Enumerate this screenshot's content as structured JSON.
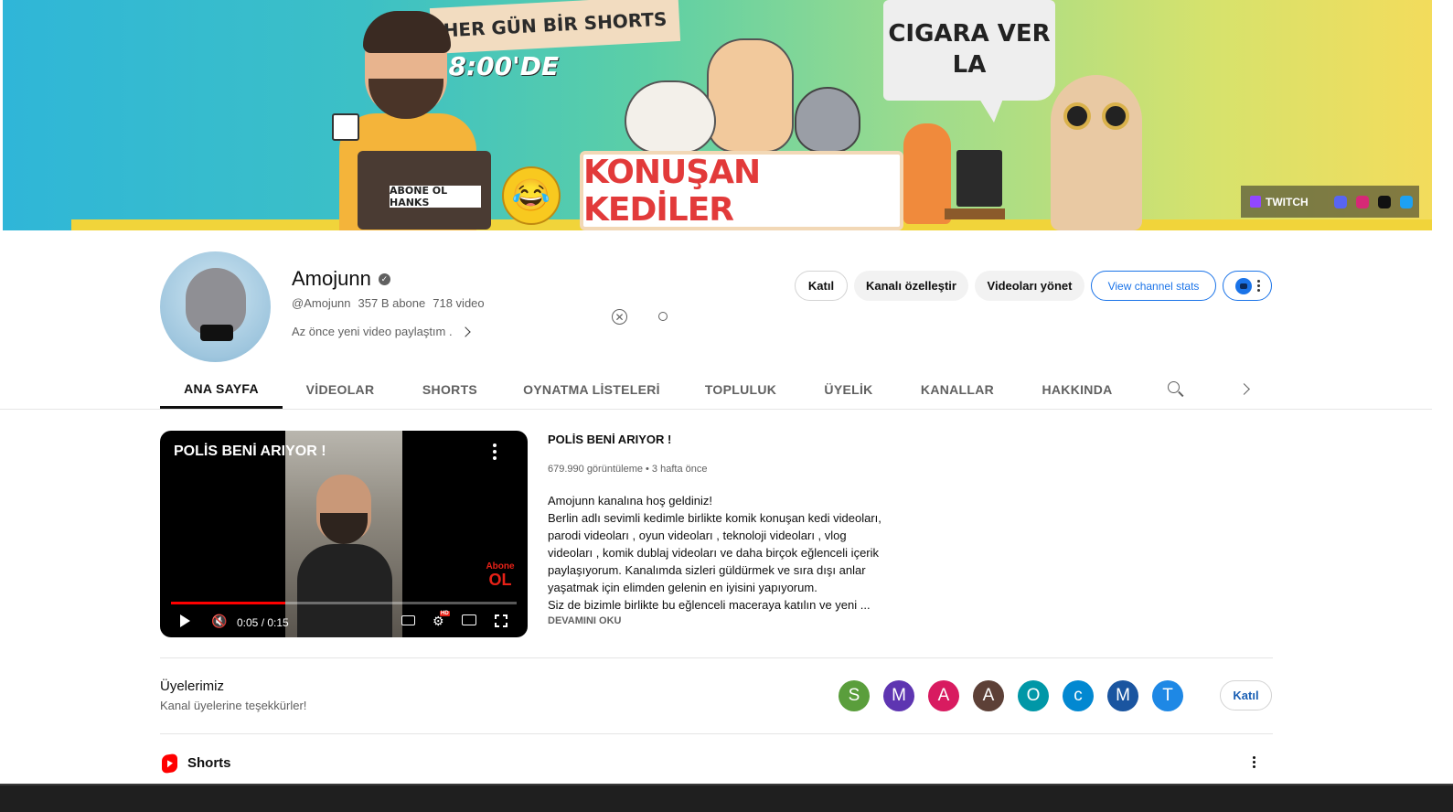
{
  "banner": {
    "shorts_sign": "HER GÜN BİR SHORTS",
    "time_text": "18:00'DE",
    "speech_line1": "CIGARA VER",
    "speech_line2": "LA",
    "laptop_label": "ABONE OL HANKS",
    "title_board": "KONUŞAN KEDİLER",
    "socials_label": "TWITCH",
    "social_colors": {
      "discord": "#5865f2",
      "instagram": "#d62976",
      "tiktok": "#111111",
      "twitter": "#1da1f2"
    }
  },
  "channel": {
    "name": "Amojunn",
    "verified_glyph": "✓",
    "handle": "@Amojunn",
    "subscribers": "357 B abone",
    "videos": "718 video",
    "description": "Az önce yeni video paylaştım .",
    "clear_glyph": "✕"
  },
  "actions": {
    "join": "Katıl",
    "customize": "Kanalı özelleştir",
    "manage_videos": "Videoları yönet",
    "stats": "View channel stats"
  },
  "tabs": [
    {
      "label": "ANA SAYFA",
      "active": true
    },
    {
      "label": "VİDEOLAR",
      "active": false
    },
    {
      "label": "SHORTS",
      "active": false
    },
    {
      "label": "OYNATMA LİSTELERİ",
      "active": false
    },
    {
      "label": "TOPLULUK",
      "active": false
    },
    {
      "label": "ÜYELİK",
      "active": false
    },
    {
      "label": "KANALLAR",
      "active": false
    },
    {
      "label": "HAKKINDA",
      "active": false
    }
  ],
  "featured_video": {
    "overlay_title": "POLİS BENİ ARIYOR !",
    "title": "POLİS BENİ ARIYOR !",
    "stats": "679.990 görüntüleme • 3 hafta önce",
    "time": "0:05 / 0:15",
    "progress": 0.33,
    "badge_top": "Abone",
    "badge_bottom": "OL",
    "hd": "HD",
    "mute_glyph": "🔇",
    "settings_glyph": "⚙",
    "description_lines": [
      "Amojunn kanalına hoş geldiniz!",
      "Berlin adlı sevimli kedimle birlikte komik konuşan kedi videoları,",
      "parodi videoları , oyun videoları , teknoloji videoları , vlog",
      "videoları , komik dublaj videoları ve daha birçok eğlenceli içerik",
      "paylaşıyorum. Kanalımda sizleri güldürmek ve sıra dışı anlar",
      "yaşatmak için elimden gelenin en iyisini yapıyorum.",
      "Siz de bizimle birlikte bu eğlenceli maceraya katılın ve yeni ..."
    ],
    "read_more": "DEVAMINI OKU"
  },
  "members": {
    "title": "Üyelerimiz",
    "subtitle": "Kanal üyelerine teşekkürler!",
    "join": "Katıl",
    "avatars": [
      {
        "letter": "S",
        "color": "#5a9e3c"
      },
      {
        "letter": "M",
        "color": "#5e35b1"
      },
      {
        "letter": "A",
        "color": "#d81b60"
      },
      {
        "letter": "A",
        "color": "#5d4037"
      },
      {
        "letter": "O",
        "color": "#0097a7"
      },
      {
        "letter": "c",
        "color": "#0288d1"
      },
      {
        "letter": "M",
        "color": "#1a55a0"
      },
      {
        "letter": "T",
        "color": "#1e88e5"
      }
    ]
  },
  "shorts_section": {
    "title": "Shorts"
  }
}
